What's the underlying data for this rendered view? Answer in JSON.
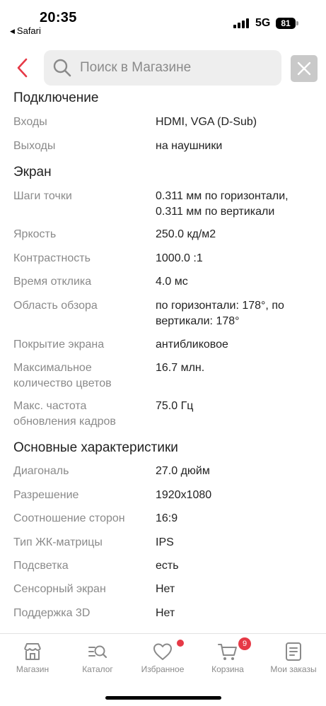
{
  "status_bar": {
    "time": "20:35",
    "back_app": "Safari",
    "network": "5G",
    "battery": "81"
  },
  "header": {
    "back_icon": "chevron-left-icon",
    "search_icon": "search-icon",
    "search_placeholder": "Поиск в Магазине",
    "clear_icon": "close-icon",
    "accent_color": "#e63946"
  },
  "sections": [
    {
      "title": "Подключение",
      "rows": [
        {
          "label": "Входы",
          "value": "HDMI, VGA (D-Sub)"
        },
        {
          "label": "Выходы",
          "value": "на наушники"
        }
      ]
    },
    {
      "title": "Экран",
      "rows": [
        {
          "label": "Шаги точки",
          "value": "0.311 мм по горизонтали, 0.311 мм по вертикали"
        },
        {
          "label": "Яркость",
          "value": "250.0 кд/м2"
        },
        {
          "label": "Контрастность",
          "value": "1000.0 :1"
        },
        {
          "label": "Время отклика",
          "value": "4.0 мс"
        },
        {
          "label": "Область обзора",
          "value": "по горизонтали: 178°, по вертикали: 178°"
        },
        {
          "label": "Покрытие экрана",
          "value": "антибликовое"
        },
        {
          "label": "Максимальное количество цветов",
          "value": "16.7 млн."
        },
        {
          "label": "Макс. частота обновления кадров",
          "value": "75.0 Гц"
        }
      ]
    },
    {
      "title": "Основные характеристики",
      "rows": [
        {
          "label": "Диагональ",
          "value": "27.0 дюйм"
        },
        {
          "label": "Разрешение",
          "value": "1920x1080"
        },
        {
          "label": "Соотношение сторон",
          "value": "16:9"
        },
        {
          "label": "Тип ЖК-матрицы",
          "value": "IPS"
        },
        {
          "label": "Подсветка",
          "value": "есть"
        },
        {
          "label": "Сенсорный экран",
          "value": "Нет"
        },
        {
          "label": "Поддержка 3D",
          "value": "Нет"
        }
      ]
    }
  ],
  "tabbar": {
    "tabs": [
      {
        "label": "Магазин",
        "icon": "store-icon"
      },
      {
        "label": "Каталог",
        "icon": "catalog-search-icon"
      },
      {
        "label": "Избранное",
        "icon": "heart-icon"
      },
      {
        "label": "Корзина",
        "icon": "cart-icon"
      },
      {
        "label": "Мои заказы",
        "icon": "orders-icon"
      }
    ],
    "cart_badge": "9"
  }
}
